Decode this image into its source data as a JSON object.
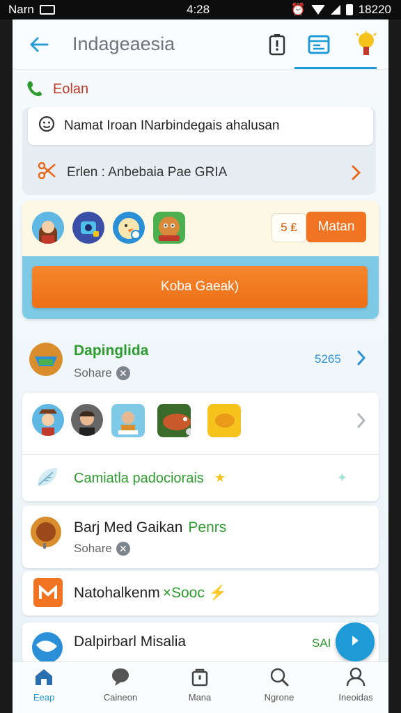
{
  "status_bar": {
    "carrier": "Narn",
    "time": "4:28",
    "right_text": "18220"
  },
  "header": {
    "title": "Indageaesia",
    "icons": [
      "back-arrow-icon",
      "phone-alert-icon",
      "browser-window-icon",
      "bulb-icon"
    ]
  },
  "section": {
    "label": "Eolan",
    "icon": "phone-icon"
  },
  "search": {
    "value": "Namat Iroan INarbindegais ahalusan",
    "icon": "smiley-search-icon"
  },
  "filter": {
    "label": "Erlen : Anbebaia Pae GRIA",
    "icon": "scissors-icon"
  },
  "promo": {
    "price": "5 ₤",
    "side_button": "Matan",
    "main_button": "Koba Gaeak)",
    "avatar_icons": [
      "avatar-girl",
      "avatar-monster",
      "avatar-bird",
      "avatar-creature"
    ]
  },
  "items": [
    {
      "title": "Dapinglida",
      "subtitle": "Sohare",
      "value": "5265"
    },
    {
      "title": "Camiatla padociorais",
      "icon": "leaf-icon"
    },
    {
      "title": "Barj Med Gaikan",
      "title_suffix": "Penrs",
      "subtitle": "Sohare"
    },
    {
      "title": "Natohalkenm",
      "title_suffix": "×Sooc ⚡"
    },
    {
      "title": "Dalpirbarl Misalia",
      "value": "SAI"
    }
  ],
  "colors": {
    "accent": "#1e9ad6",
    "orange": "#f07422",
    "green": "#2e9b2e",
    "red": "#c0392b"
  },
  "nav": [
    {
      "label": "Eeap",
      "icon": "home-icon",
      "active": true
    },
    {
      "label": "Caineon",
      "icon": "chat-icon"
    },
    {
      "label": "Mana",
      "icon": "bag-icon"
    },
    {
      "label": "Ngrone",
      "icon": "search-icon"
    },
    {
      "label": "Ineoidas",
      "icon": "person-icon"
    }
  ]
}
